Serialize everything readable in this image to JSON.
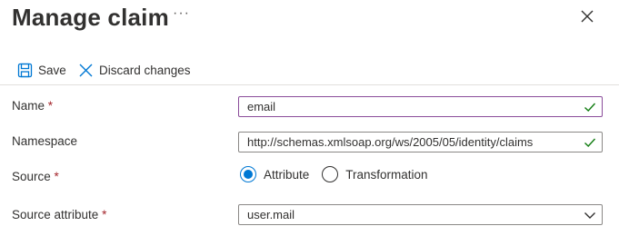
{
  "panel": {
    "title": "Manage claim",
    "more_label": "···"
  },
  "toolbar": {
    "save_label": "Save",
    "discard_label": "Discard changes"
  },
  "form": {
    "name": {
      "label": "Name",
      "required_mark": "*",
      "value": "email",
      "valid": true
    },
    "namespace": {
      "label": "Namespace",
      "value": "http://schemas.xmlsoap.org/ws/2005/05/identity/claims",
      "valid": true
    },
    "source": {
      "label": "Source",
      "required_mark": "*",
      "options": [
        {
          "label": "Attribute",
          "checked": true
        },
        {
          "label": "Transformation",
          "checked": false
        }
      ]
    },
    "source_attribute": {
      "label": "Source attribute",
      "required_mark": "*",
      "value": "user.mail"
    }
  },
  "colors": {
    "accent": "#0078d4",
    "valid_check": "#107c10",
    "required": "#a4262c",
    "focus_border": "#8a4c9a"
  },
  "icons": {
    "save": "save-icon",
    "discard": "close-icon",
    "close": "close-icon",
    "valid": "checkmark-icon",
    "dropdown": "chevron-down-icon"
  }
}
